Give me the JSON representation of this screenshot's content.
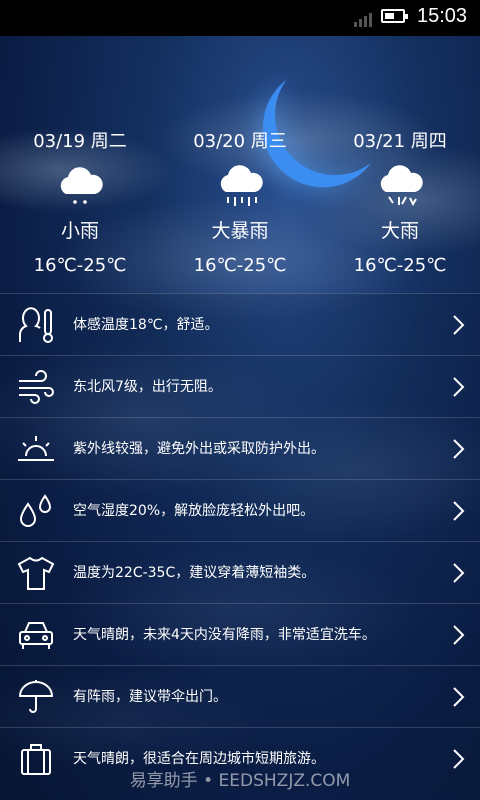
{
  "status_bar": {
    "time": "15:03",
    "icons": [
      "signal-icon",
      "battery-icon"
    ]
  },
  "forecast": [
    {
      "date": "03/19 周二",
      "condition": "小雨",
      "temp": "16℃-25℃",
      "icon": "light-rain-icon"
    },
    {
      "date": "03/20 周三",
      "condition": "大暴雨",
      "temp": "16℃-25℃",
      "icon": "heavy-rainstorm-icon"
    },
    {
      "date": "03/21 周四",
      "condition": "大雨",
      "temp": "16℃-25℃",
      "icon": "heavy-rain-icon"
    }
  ],
  "tips": [
    {
      "icon": "body-temperature-icon",
      "text": "体感温度18℃，舒适。"
    },
    {
      "icon": "wind-icon",
      "text": "东北风7级，出行无阻。"
    },
    {
      "icon": "sunrise-uv-icon",
      "text": "紫外线较强，避免外出或采取防护外出。"
    },
    {
      "icon": "humidity-drops-icon",
      "text": "空气湿度20%，解放脸庞轻松外出吧。"
    },
    {
      "icon": "tshirt-icon",
      "text": "温度为22C-35C，建议穿着薄短袖类。"
    },
    {
      "icon": "car-icon",
      "text": "天气晴朗，未来4天内没有降雨，非常适宜洗车。"
    },
    {
      "icon": "umbrella-icon",
      "text": "有阵雨，建议带伞出门。"
    },
    {
      "icon": "luggage-icon",
      "text": "天气晴朗，很适合在周边城市短期旅游。"
    }
  ],
  "watermark": "易享助手 • EEDSHZJZ.COM",
  "colors": {
    "accent_moon": "#3b8df1",
    "background": "#0b1d45"
  }
}
